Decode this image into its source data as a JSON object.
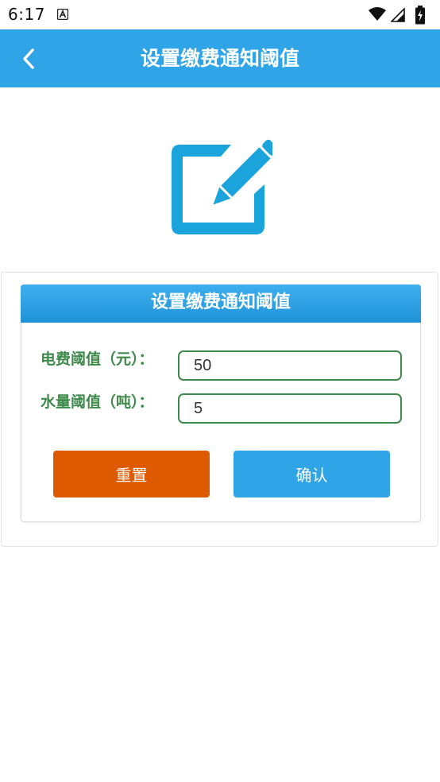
{
  "status_bar": {
    "time": "6:17",
    "icons": [
      "a-notification-icon",
      "wifi-icon",
      "signal-icon",
      "battery-charging-icon"
    ]
  },
  "app_bar": {
    "title": "设置缴费通知阈值",
    "back_icon": "chevron-left-icon",
    "background": "#2fa4e7"
  },
  "hero": {
    "icon": "edit-icon",
    "color": "#1ba4dc"
  },
  "panel": {
    "title": "设置缴费通知阈值",
    "fields": [
      {
        "label": "电费阈值（元）：",
        "value": "50"
      },
      {
        "label": "水量阈值（吨）：",
        "value": "5"
      }
    ],
    "reset_label": "重置",
    "confirm_label": "确认",
    "colors": {
      "label": "#3d8a4a",
      "reset": "#dd5a00",
      "confirm": "#2fa4e7"
    }
  }
}
